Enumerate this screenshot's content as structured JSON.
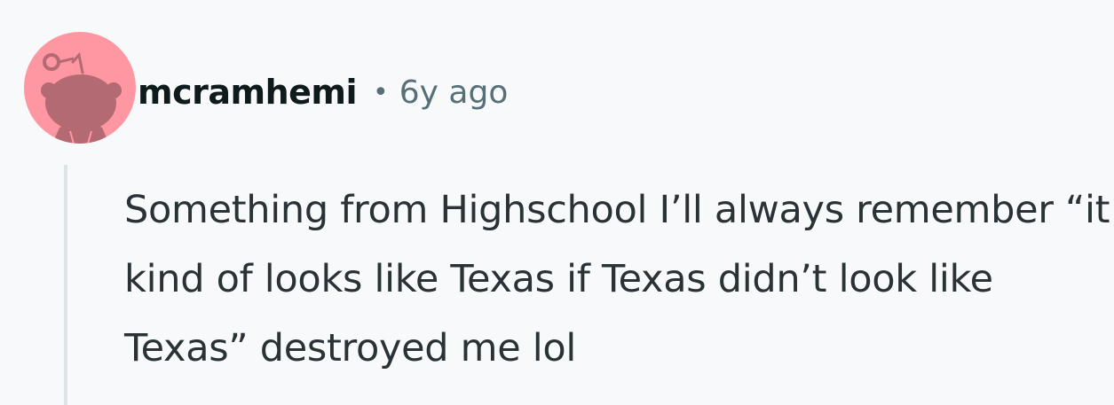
{
  "comment": {
    "username": "mcramhemi",
    "separator": "•",
    "timestamp": "6y ago",
    "body": "Something from Highschool I’ll always remember “it kind of looks like Texas if Texas didn’t look like Texas” destroyed me lol",
    "avatar_icon": "reddit-snoo-icon"
  },
  "colors": {
    "background": "#f8f9fa",
    "avatar_background": "#ff97a3",
    "avatar_figure": "#b36a72",
    "username": "#0f1a1c",
    "meta": "#576f76",
    "body_text": "#2a3236",
    "thread_line": "#dbe4e9"
  }
}
